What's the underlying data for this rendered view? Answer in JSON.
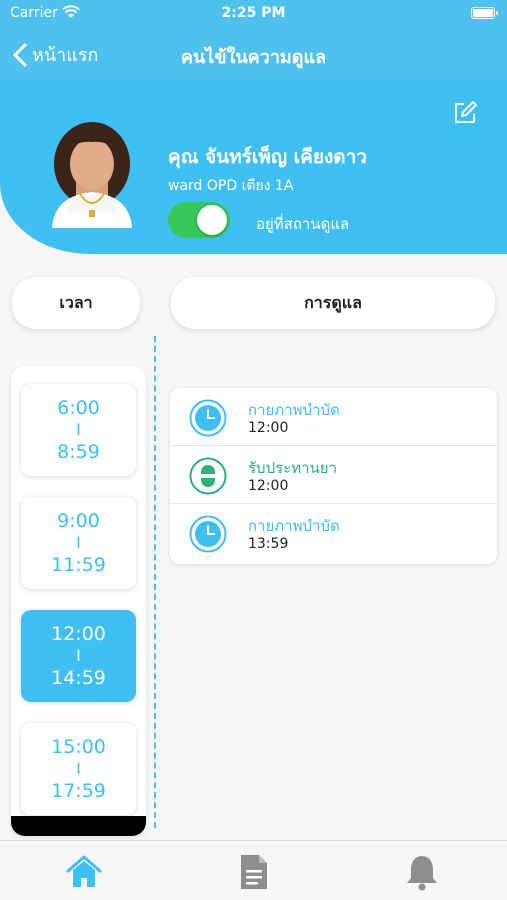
{
  "status_bar": {
    "carrier": "Carrier",
    "time": "2:25 PM"
  },
  "nav": {
    "back_label": "หน้าแรก",
    "title": "คนไข้ในความดูแล"
  },
  "profile": {
    "name": "คุณ จันทร์เพ็ญ เคียงดาว",
    "ward": "ward OPD เตียง 1A",
    "toggle_on": true,
    "toggle_label": "อยู่ที่สถานดูแล"
  },
  "columns": {
    "time_header": "เวลา",
    "care_header": "การดูแล"
  },
  "time_slots": [
    {
      "start": "6:00",
      "sep": "I",
      "end": "8:59",
      "active": false
    },
    {
      "start": "9:00",
      "sep": "I",
      "end": "11:59",
      "active": false
    },
    {
      "start": "12:00",
      "sep": "I",
      "end": "14:59",
      "active": true
    },
    {
      "start": "15:00",
      "sep": "I",
      "end": "17:59",
      "active": false
    }
  ],
  "care_items": [
    {
      "label": "กายภาพบำบัด",
      "time": "12:00",
      "icon": "clock-icon"
    },
    {
      "label": "รับประทานยา",
      "time": "12:00",
      "icon": "pill-icon"
    },
    {
      "label": "กายภาพบำบัด",
      "time": "13:59",
      "icon": "clock-icon"
    }
  ],
  "tabs": [
    {
      "name": "home",
      "icon": "home-icon",
      "active": true
    },
    {
      "name": "document",
      "icon": "document-icon",
      "active": false
    },
    {
      "name": "notifications",
      "icon": "bell-icon",
      "active": false
    }
  ],
  "colors": {
    "primary": "#3fbff2",
    "accent_green": "#2eaf7d",
    "toggle_on": "#35c759",
    "inactive_icon": "#8e8e8e"
  }
}
